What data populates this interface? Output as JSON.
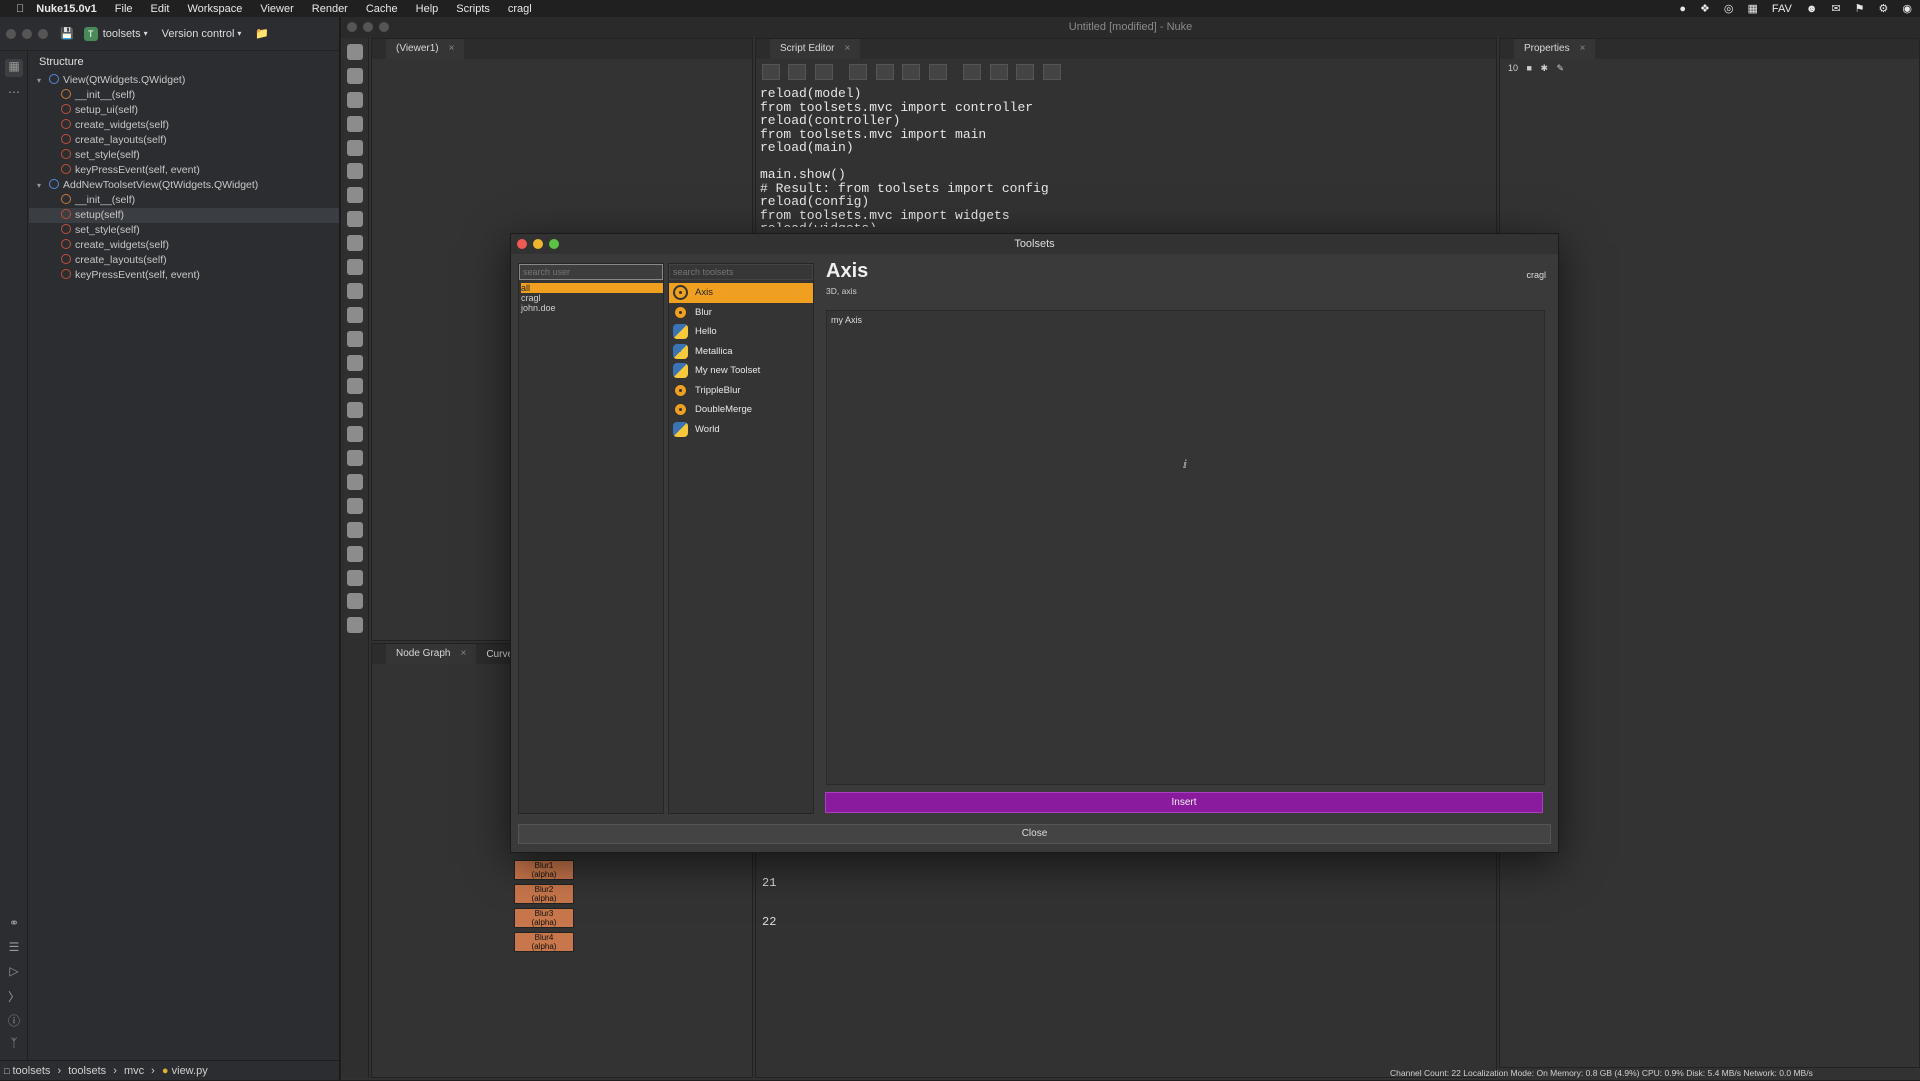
{
  "menubar": {
    "app": "Nuke15.0v1",
    "items": [
      "File",
      "Edit",
      "Workspace",
      "Viewer",
      "Render",
      "Cache",
      "Help",
      "Scripts",
      "cragl"
    ],
    "right": [
      "FAV"
    ]
  },
  "ide": {
    "project": "toolsets",
    "project_icon_letter": "T",
    "vcs": "Version control",
    "structure_title": "Structure",
    "tree": [
      {
        "kind": "class",
        "label": "View(QtWidgets.QWidget)"
      },
      {
        "kind": "method",
        "label": "__init__(self)",
        "lock": true
      },
      {
        "kind": "method",
        "label": "setup_ui(self)"
      },
      {
        "kind": "method",
        "label": "create_widgets(self)"
      },
      {
        "kind": "method",
        "label": "create_layouts(self)"
      },
      {
        "kind": "method",
        "label": "set_style(self)"
      },
      {
        "kind": "method",
        "label": "keyPressEvent(self, event)"
      },
      {
        "kind": "class",
        "label": "AddNewToolsetView(QtWidgets.QWidget)"
      },
      {
        "kind": "method",
        "label": "__init__(self)",
        "lock": true
      },
      {
        "kind": "method",
        "label": "setup(self)",
        "selected": true
      },
      {
        "kind": "method",
        "label": "set_style(self)"
      },
      {
        "kind": "method",
        "label": "create_widgets(self)"
      },
      {
        "kind": "method",
        "label": "create_layouts(self)"
      },
      {
        "kind": "method",
        "label": "keyPressEvent(self, event)"
      }
    ],
    "breadcrumb": [
      "toolsets",
      "toolsets",
      "mvc",
      "view.py"
    ]
  },
  "nuke": {
    "window_title": "Untitled [modified] - Nuke",
    "viewer_tab": "(Viewer1)",
    "script_editor_tab": "Script Editor",
    "properties_tab": "Properties",
    "properties_count": "10",
    "node_graph_tab": "Node Graph",
    "curve_tab": "Curve",
    "code": "reload(model)\nfrom toolsets.mvc import controller\nreload(controller)\nfrom toolsets.mvc import main\nreload(main)\n\nmain.show()\n# Result: from toolsets import config\nreload(config)\nfrom toolsets.mvc import widgets\nreload(widgets)",
    "line_numbers": [
      "21",
      "22"
    ],
    "nodes": [
      {
        "label": "Blur1",
        "sub": "(alpha)"
      },
      {
        "label": "Blur2",
        "sub": "(alpha)"
      },
      {
        "label": "Blur3",
        "sub": "(alpha)"
      },
      {
        "label": "Blur4",
        "sub": "(alpha)"
      }
    ],
    "status": "Channel Count: 22  Localization Mode: On  Memory: 0.8 GB (4.9%)  CPU: 0.9%  Disk: 5.4 MB/s  Network: 0.0 MB/s"
  },
  "dialog": {
    "title": "Toolsets",
    "search_user_placeholder": "search user",
    "search_toolsets_placeholder": "search toolsets",
    "users": [
      {
        "name": "all",
        "selected": true
      },
      {
        "name": "cragl"
      },
      {
        "name": "john.doe"
      }
    ],
    "toolsets": [
      {
        "name": "Axis",
        "icon": "nuke",
        "selected": true
      },
      {
        "name": "Blur",
        "icon": "nuke"
      },
      {
        "name": "Hello",
        "icon": "python"
      },
      {
        "name": "Metallica",
        "icon": "python"
      },
      {
        "name": "My new Toolset",
        "icon": "python"
      },
      {
        "name": "TrippleBlur",
        "icon": "nuke"
      },
      {
        "name": "DoubleMerge",
        "icon": "nuke"
      },
      {
        "name": "World",
        "icon": "python"
      }
    ],
    "detail": {
      "name": "Axis",
      "tags": "3D, axis",
      "author": "cragl",
      "description": "my Axis"
    },
    "insert_label": "Insert",
    "close_label": "Close",
    "colors": {
      "accent": "#f0a020",
      "insert": "#8a1a9e"
    }
  }
}
